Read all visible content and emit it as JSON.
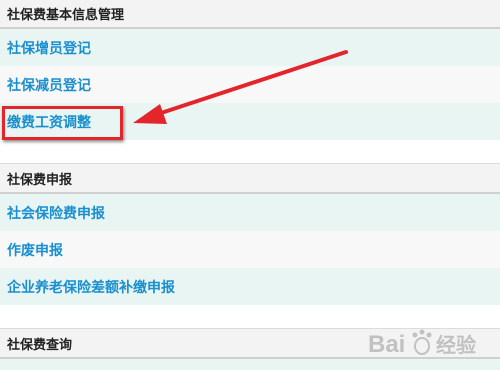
{
  "sections": [
    {
      "title": "社保费基本信息管理"
    },
    {
      "title": "社保费申报"
    },
    {
      "title": "社保费查询"
    }
  ],
  "section1_items": [
    {
      "label": "社保增员登记"
    },
    {
      "label": "社保减员登记"
    },
    {
      "label": "缴费工资调整"
    }
  ],
  "section2_items": [
    {
      "label": "社会保险费申报"
    },
    {
      "label": "作废申报"
    },
    {
      "label": "企业养老保险差额补缴申报"
    }
  ],
  "colors": {
    "link": "#1a8fcf",
    "highlight": "#e3262b",
    "row_tint": "#e8f5f3"
  },
  "annotation": {
    "highlighted_item": "缴费工资调整"
  },
  "watermark": {
    "brand_text": "Bai",
    "brand_suffix": "经验"
  }
}
